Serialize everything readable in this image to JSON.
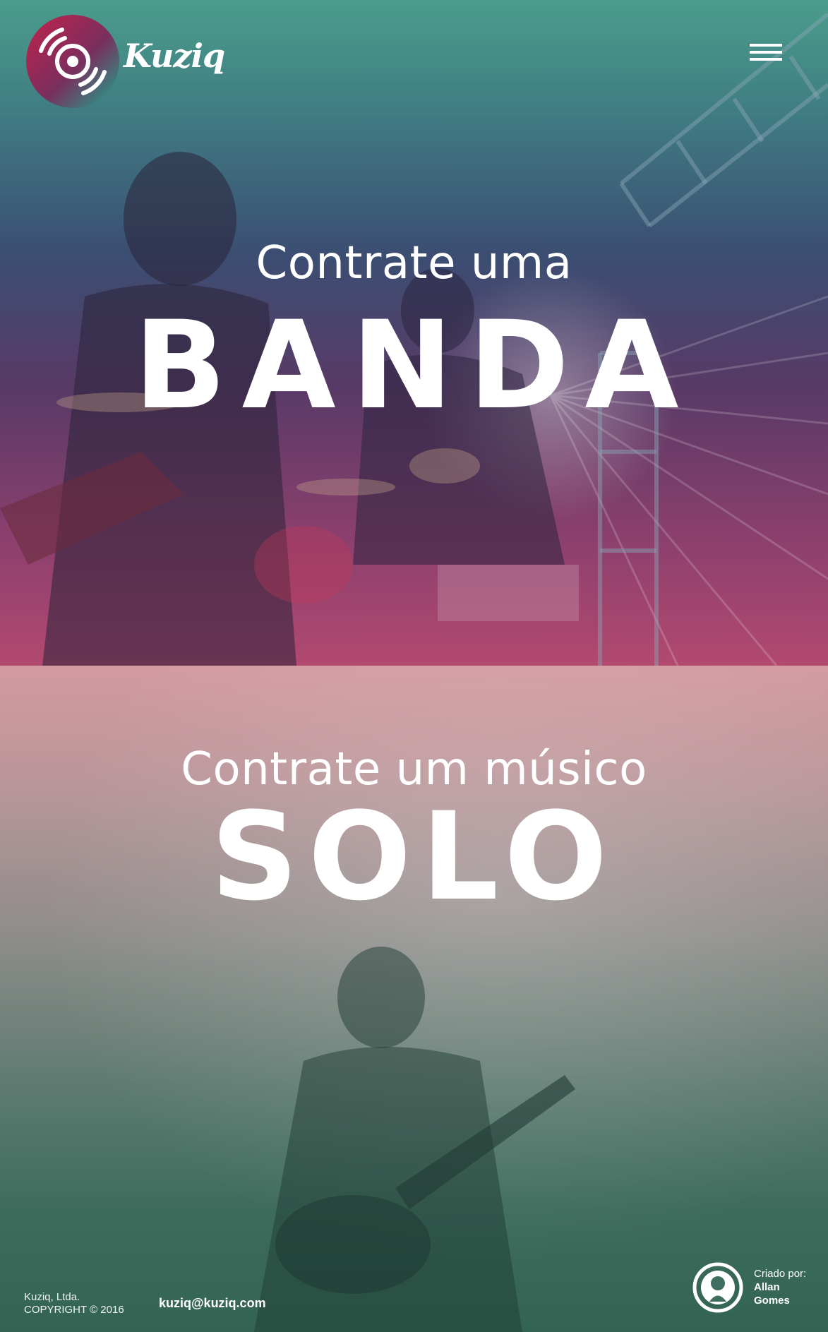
{
  "brand": {
    "name": "Kuziq",
    "accent_start": "#c2234b",
    "accent_end": "#1aa98f"
  },
  "nav": {
    "menu_icon": "hamburger-menu-icon"
  },
  "hero_banda": {
    "caption": "Contrate uma",
    "headline": "BANDA"
  },
  "hero_solo": {
    "caption": "Contrate um músico",
    "headline": "SOLO"
  },
  "footer": {
    "company": "Kuziq, Ltda.",
    "copyright": "COPYRIGHT © 2016",
    "email": "kuziq@kuziq.com",
    "credit_label": "Criado por:",
    "credit_first": "Allan",
    "credit_last": "Gomes",
    "credit_icon": "author-avatar-icon"
  }
}
